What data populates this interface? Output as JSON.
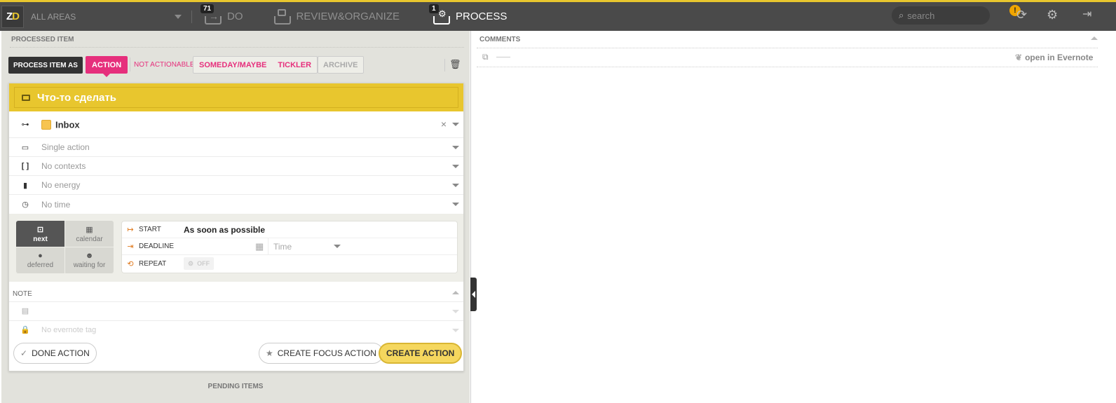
{
  "topbar": {
    "logo": {
      "z": "Z",
      "d": "D"
    },
    "areas_label": "ALL AREAS",
    "tabs": [
      {
        "label": "DO",
        "badge": "71"
      },
      {
        "label": "REVIEW&ORGANIZE"
      },
      {
        "label": "PROCESS",
        "badge": "1"
      }
    ],
    "search_placeholder": "search",
    "alert_badge": "!"
  },
  "left": {
    "section_title": "PROCESSED ITEM",
    "process_as_label": "PROCESS ITEM AS",
    "type_buttons": {
      "action": "ACTION",
      "not_actionable": "NOT ACTIONABLE",
      "someday": "SOMEDAY/MAYBE",
      "tickler": "TICKLER",
      "archive": "ARCHIVE"
    },
    "item_title": "Что-то сделать",
    "fields": {
      "project": "Inbox",
      "type": "Single action",
      "contexts": "No contexts",
      "energy": "No energy",
      "time": "No time"
    },
    "schedule_modes": [
      {
        "label": "next"
      },
      {
        "label": "calendar"
      },
      {
        "label": "deferred"
      },
      {
        "label": "waiting for"
      }
    ],
    "dates": {
      "start_label": "START",
      "start_value": "As soon as possible",
      "deadline_label": "DEADLINE",
      "time_placeholder": "Time",
      "repeat_label": "REPEAT",
      "repeat_value": "OFF"
    },
    "note": {
      "title": "NOTE",
      "evernote_tag_placeholder": "No evernote tag"
    },
    "footer": {
      "done_label": "DONE ACTION",
      "focus_label": "CREATE FOCUS ACTION",
      "create_label": "CREATE ACTION"
    },
    "pending_title": "PENDING ITEMS"
  },
  "right": {
    "comments_title": "COMMENTS",
    "open_evernote": "open in Evernote"
  },
  "colors": {
    "accent_yellow": "#e8c62e",
    "accent_pink": "#e62f7c",
    "topbar_bg": "#4a4a4a"
  }
}
